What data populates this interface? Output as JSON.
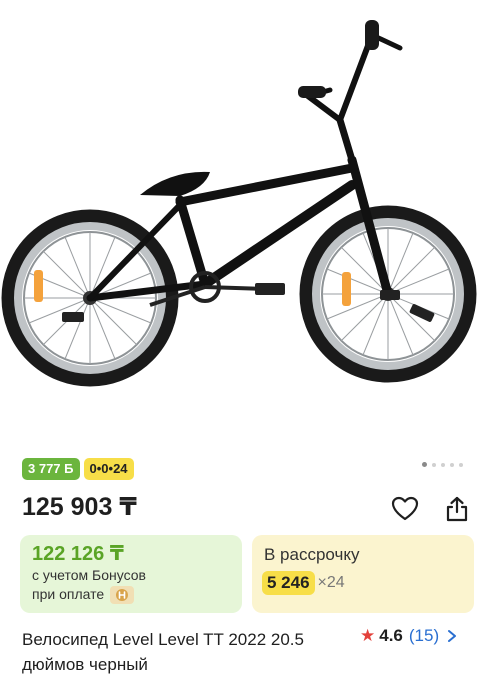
{
  "product": {
    "image_alt": "bmx-bicycle-photo",
    "badges": {
      "bonus": "3 777 Б",
      "installment": "0•0•24"
    },
    "carousel": {
      "total": 5,
      "active": 0
    },
    "price": "125 903 ₸",
    "bonus_card": {
      "price": "122 126 ₸",
      "line1": "с учетом Бонусов",
      "line2": "при оплате"
    },
    "installment_card": {
      "title": "В рассрочку",
      "amount": "5 246",
      "multiplier": "×24"
    },
    "title": "Велосипед Level Level TT 2022 20.5 дюймов черный",
    "rating": {
      "value": "4.6",
      "count": "(15)"
    }
  },
  "colors": {
    "bonus_green": "#6bb53d",
    "installment_yellow": "#f7de48",
    "star_red": "#e3413b",
    "link_blue": "#2a6fd1"
  },
  "icons": [
    "heart-icon",
    "share-icon",
    "coin-icon",
    "star-icon",
    "chevron-right-icon"
  ]
}
